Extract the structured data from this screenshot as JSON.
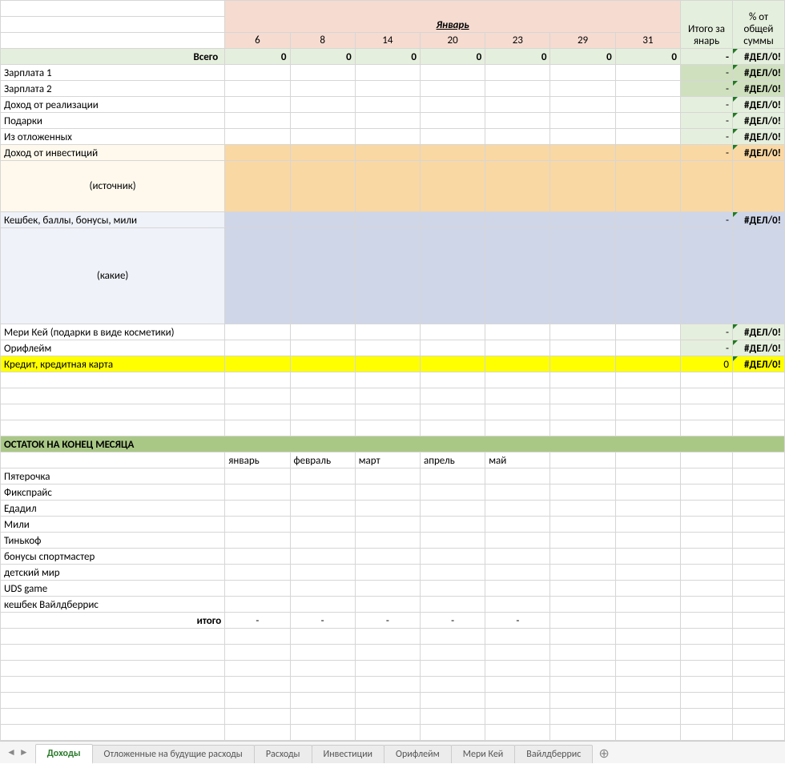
{
  "header": {
    "month_title": "Январь",
    "days": [
      "6",
      "8",
      "14",
      "20",
      "23",
      "29",
      "31"
    ],
    "itogo_label_l1": "Итого за",
    "itogo_label_l2": "янарь",
    "pct_label_l1": "% от",
    "pct_label_l2": "общей",
    "pct_label_l3": "суммы"
  },
  "vsego": {
    "label": "Всего",
    "day_vals": [
      "0",
      "0",
      "0",
      "0",
      "0",
      "0",
      "0"
    ],
    "itogo": "-",
    "pct": "#ДЕЛ/0!"
  },
  "rows": [
    {
      "label": "Зарплата 1",
      "itogo": "-",
      "pct": "#ДЕЛ/0!",
      "itogo_strong": true
    },
    {
      "label": "Зарплата 2",
      "itogo": "-",
      "pct": "#ДЕЛ/0!",
      "itogo_strong": true
    },
    {
      "label": "Доход от реализации",
      "itogo": "-",
      "pct": "#ДЕЛ/0!"
    },
    {
      "label": "Подарки",
      "itogo": "-",
      "pct": "#ДЕЛ/0!"
    },
    {
      "label": "Из отложенных",
      "itogo": "-",
      "pct": "#ДЕЛ/0!"
    }
  ],
  "invest": {
    "title": "Доход от инвестиций",
    "sub": "(источник)",
    "itogo": "-",
    "pct": "#ДЕЛ/0!"
  },
  "cashback": {
    "title": "Кешбек, баллы, бонусы, мили",
    "sub": "(какие)",
    "itogo": "-",
    "pct": "#ДЕЛ/0!"
  },
  "rows2": [
    {
      "label": "Мери Кей (подарки в виде косметики)",
      "itogo": "-",
      "pct": "#ДЕЛ/0!"
    },
    {
      "label": "Орифлейм",
      "itogo": "-",
      "pct": "#ДЕЛ/0!"
    }
  ],
  "credit": {
    "label": "Кредит, кредитная карта",
    "itogo": "0",
    "pct": "#ДЕЛ/0!"
  },
  "balance": {
    "header": "ОСТАТОК НА КОНЕЦ МЕСЯЦА",
    "months": [
      "январь",
      "февраль",
      "март",
      "апрель",
      "май"
    ],
    "items": [
      "Пятерочка",
      "Фикспрайс",
      "Едадил",
      "Мили",
      "Тинькоф",
      "бонусы спортмастер",
      "детский мир",
      "UDS game",
      "кешбек Вайлдберрис"
    ],
    "itogo_label": "итого",
    "itogo_vals": [
      "-",
      "-",
      "-",
      "-",
      "-"
    ]
  },
  "tabs": {
    "active": "Доходы",
    "others": [
      "Отложенные на будущие расходы",
      "Расходы",
      "Инвестиции",
      "Орифлейм",
      "Мери Кей",
      "Вайлдберрис"
    ]
  }
}
